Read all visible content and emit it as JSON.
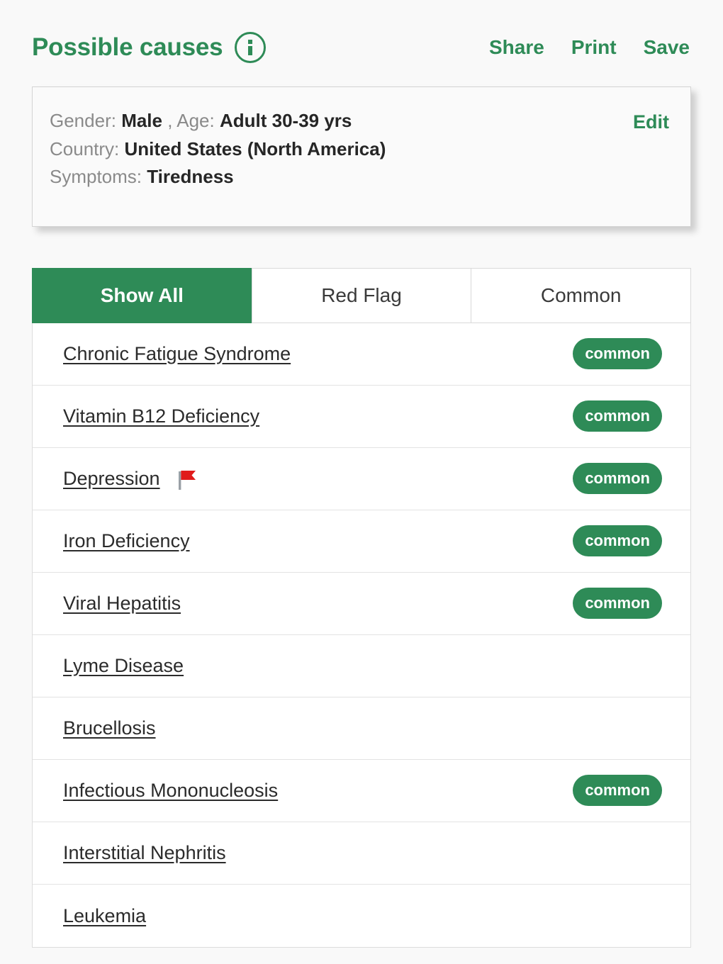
{
  "header": {
    "title": "Possible causes",
    "info_icon": "info-circle-icon",
    "actions": [
      {
        "label": "Share",
        "name": "share"
      },
      {
        "label": "Print",
        "name": "print"
      },
      {
        "label": "Save",
        "name": "save"
      }
    ]
  },
  "summary": {
    "edit_label": "Edit",
    "lines": [
      {
        "label": "Gender:",
        "value": "Male",
        "label2": ", Age:",
        "value2": "Adult 30-39 yrs"
      },
      {
        "label": "Country:",
        "value": "United States (North America)"
      },
      {
        "label": "Symptoms:",
        "value": "Tiredness"
      }
    ]
  },
  "tabs": [
    {
      "label": "Show All",
      "active": true
    },
    {
      "label": "Red Flag",
      "active": false
    },
    {
      "label": "Common",
      "active": false
    }
  ],
  "causes": [
    {
      "name": "Chronic Fatigue Syndrome",
      "badge": "common",
      "red_flag": false
    },
    {
      "name": "Vitamin B12 Deficiency",
      "badge": "common",
      "red_flag": false
    },
    {
      "name": "Depression",
      "badge": "common",
      "red_flag": true
    },
    {
      "name": "Iron Deficiency",
      "badge": "common",
      "red_flag": false
    },
    {
      "name": "Viral Hepatitis",
      "badge": "common",
      "red_flag": false
    },
    {
      "name": "Lyme Disease",
      "badge": "",
      "red_flag": false
    },
    {
      "name": "Brucellosis",
      "badge": "",
      "red_flag": false
    },
    {
      "name": "Infectious Mononucleosis",
      "badge": "common",
      "red_flag": false
    },
    {
      "name": "Interstitial Nephritis",
      "badge": "",
      "red_flag": false
    },
    {
      "name": "Leukemia",
      "badge": "",
      "red_flag": false
    }
  ],
  "colors": {
    "brand_green": "#2e8b57",
    "page_background": "#f9f9f9",
    "red_flag": "#e01b1b",
    "text_dark": "#2b2b2b",
    "text_muted": "#8a8a8a"
  }
}
